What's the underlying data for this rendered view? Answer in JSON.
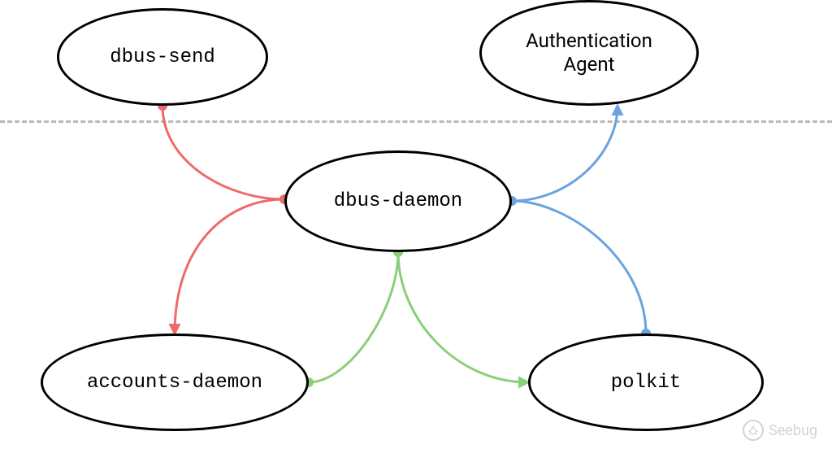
{
  "diagram": {
    "nodes": {
      "dbus_send": "dbus-send",
      "auth_agent": "Authentication\nAgent",
      "dbus_daemon": "dbus-daemon",
      "accounts_daemon": "accounts-daemon",
      "polkit": "polkit"
    },
    "edges": [
      {
        "from": "dbus-send",
        "to": "dbus-daemon",
        "color": "#ef6a6a"
      },
      {
        "from": "dbus-daemon",
        "to": "accounts-daemon",
        "color": "#ef6a6a"
      },
      {
        "from": "dbus-daemon",
        "to": "accounts-daemon",
        "color": "#8bcf7a"
      },
      {
        "from": "dbus-daemon",
        "to": "polkit",
        "color": "#8bcf7a"
      },
      {
        "from": "polkit",
        "to": "dbus-daemon",
        "color": "#6aa3e0"
      },
      {
        "from": "dbus-daemon",
        "to": "Authentication Agent",
        "color": "#6aa3e0"
      }
    ],
    "colors": {
      "red": "#ef6a6a",
      "green": "#8bcf7a",
      "blue": "#6aa3e0",
      "separator": "#b9b9b9"
    }
  },
  "watermark": {
    "label": "Seebug"
  }
}
